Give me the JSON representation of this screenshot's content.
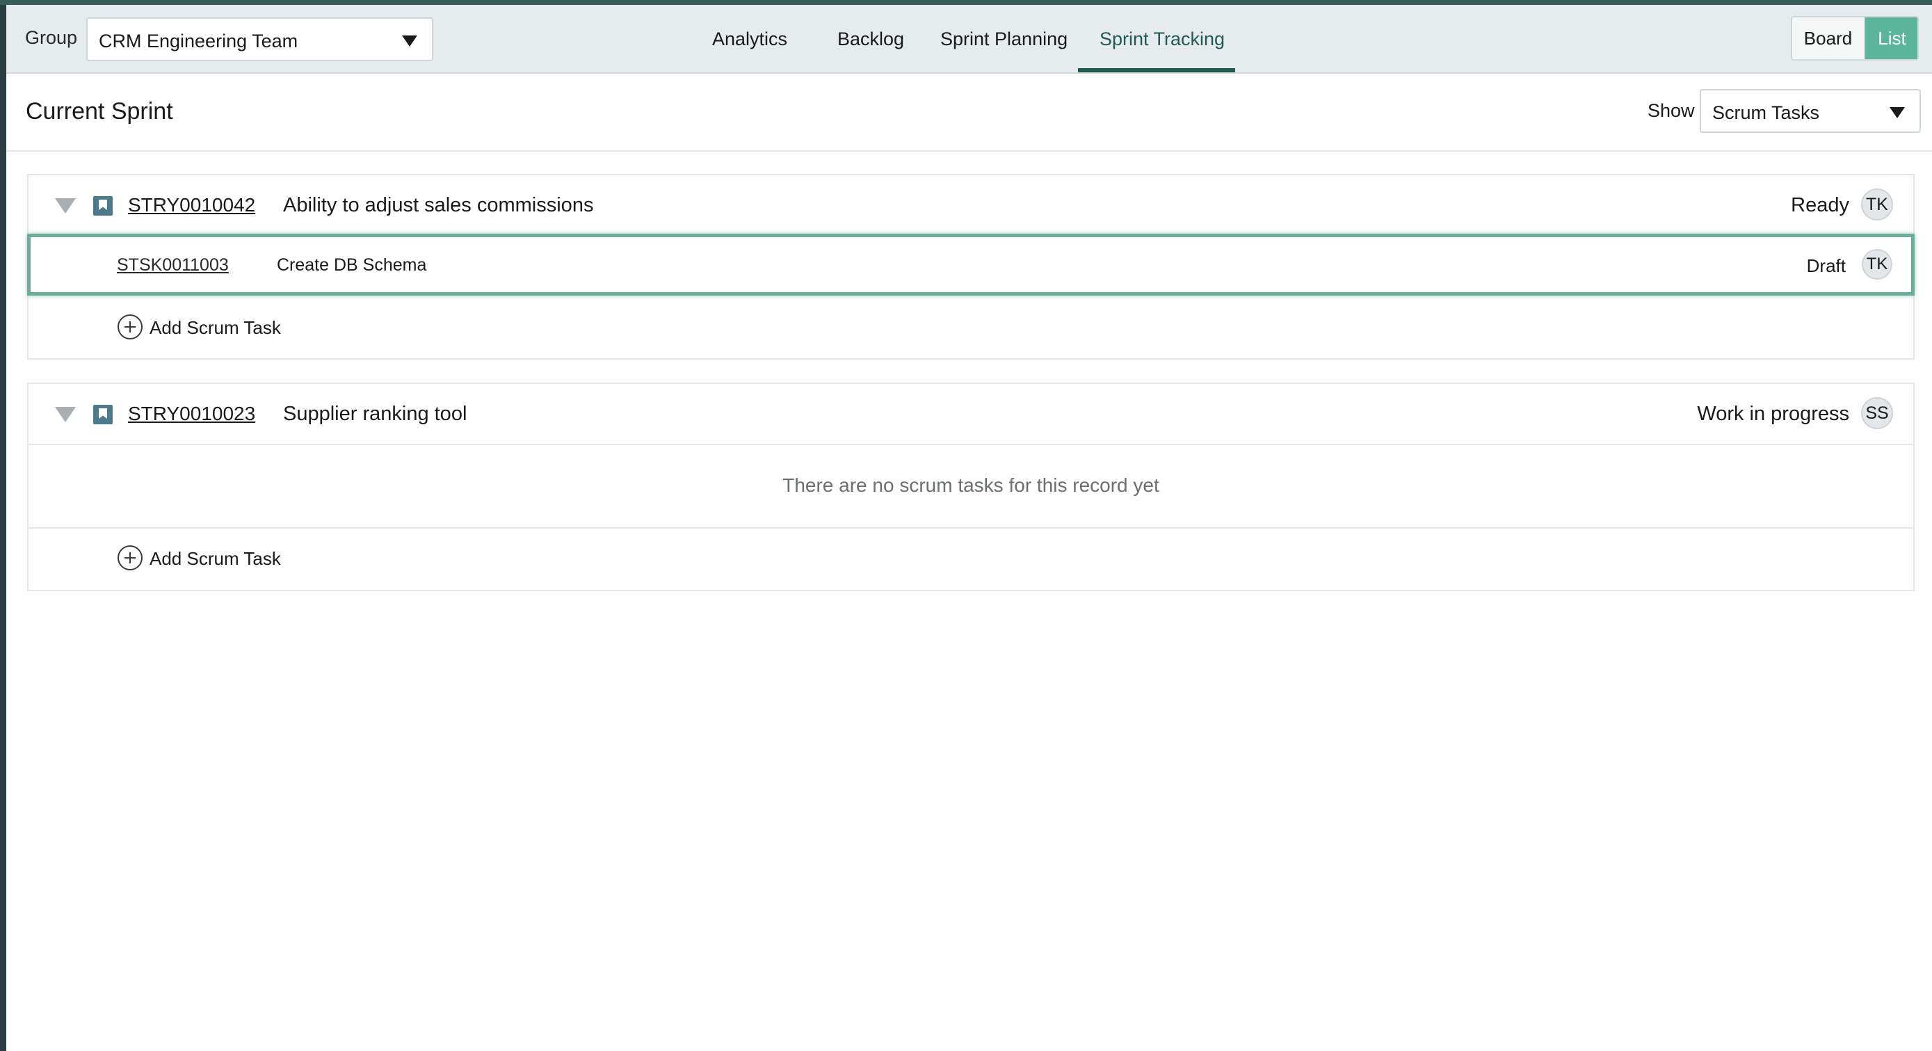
{
  "header": {
    "group_label": "Group",
    "group_value": "CRM Engineering Team",
    "tabs": [
      {
        "label": "Analytics"
      },
      {
        "label": "Backlog"
      },
      {
        "label": "Sprint Planning"
      },
      {
        "label": "Sprint Tracking",
        "active": true
      }
    ],
    "view_toggle": {
      "board_label": "Board",
      "list_label": "List",
      "selected": "List"
    }
  },
  "sprint": {
    "title": "Current Sprint",
    "show_label": "Show",
    "show_value": "Scrum Tasks"
  },
  "stories": [
    {
      "number": "STRY0010042",
      "title": "Ability to adjust sales commissions",
      "state": "Ready",
      "assignee": "TK",
      "tasks": [
        {
          "number": "STSK0011003",
          "title": "Create DB Schema",
          "state": "Draft",
          "assignee": "TK",
          "selected": true
        }
      ],
      "add_task_label": "Add Scrum Task"
    },
    {
      "number": "STRY0010023",
      "title": "Supplier ranking tool",
      "state": "Work in progress",
      "assignee": "SS",
      "tasks": [],
      "empty_message": "There are no scrum tasks for this record yet",
      "add_task_label": "Add Scrum Task"
    }
  ],
  "colors": {
    "accent": "#1f5b4f",
    "toggle_active": "#5bb59b",
    "selected_border": "#6aad9b",
    "story_icon": "#4a7a8c",
    "sidebar": "#2d3e43"
  },
  "icons": [
    "chevron-down-icon",
    "collapse-arrow-icon",
    "story-icon",
    "plus-circle-icon"
  ]
}
